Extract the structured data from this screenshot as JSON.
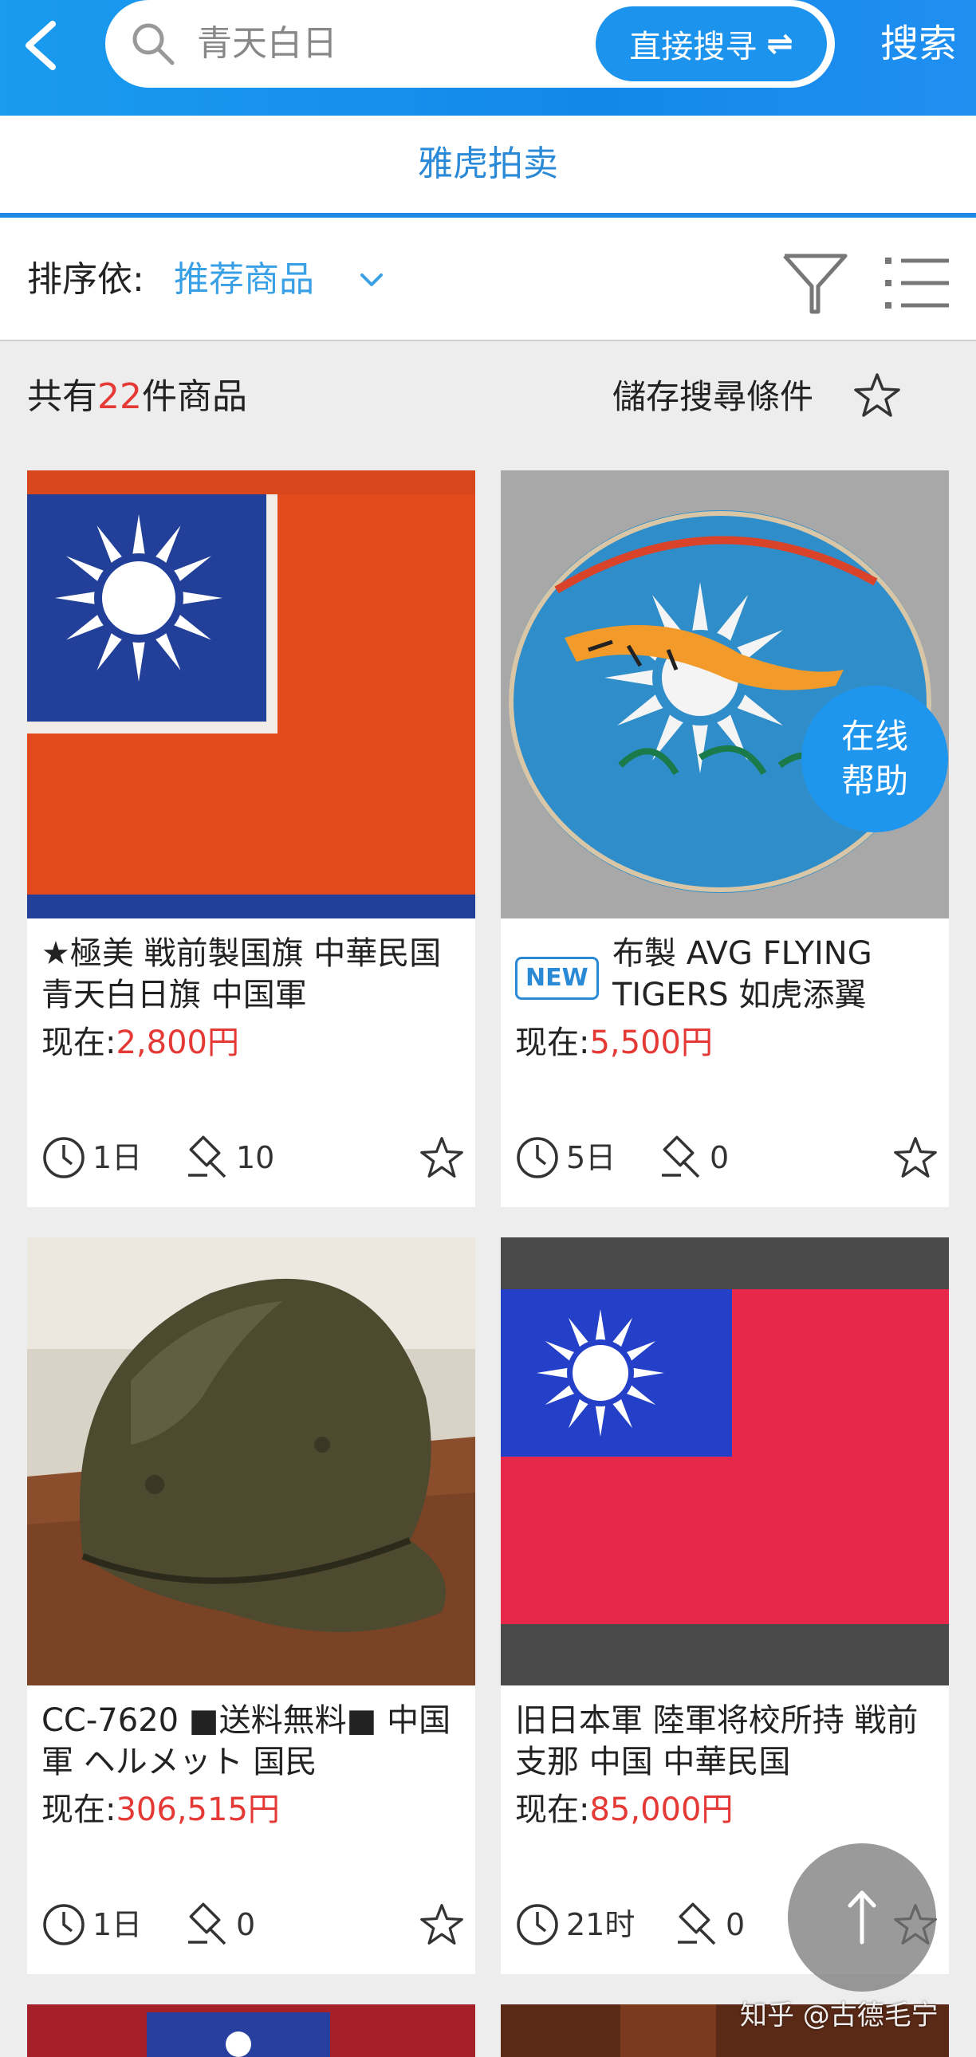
{
  "header": {
    "search_placeholder": "青天白日",
    "direct_search_label": "直接搜寻",
    "direct_search_icon": "⇌",
    "search_button": "搜索",
    "accent": "#1a9bef"
  },
  "tab": {
    "label": "雅虎拍卖"
  },
  "sort": {
    "label": "排序依:",
    "value": "推荐商品"
  },
  "results": {
    "prefix": "共有",
    "count": "22",
    "suffix": "件商品",
    "save_label": "儲存搜尋條件"
  },
  "items": [
    {
      "title": "★極美 戦前製国旗 中華民国 青天白日旗 中国軍",
      "price_label": "现在:",
      "price": "2,800円",
      "time": "1日",
      "bids": "10",
      "badge": ""
    },
    {
      "title": "布製 AVG FLYING TIGERS 如虎添翼",
      "price_label": "现在:",
      "price": "5,500円",
      "time": "5日",
      "bids": "0",
      "badge": "NEW"
    },
    {
      "title": "CC-7620 ■送料無料■ 中国軍 ヘルメット 国民",
      "price_label": "现在:",
      "price": "306,515円",
      "time": "1日",
      "bids": "0",
      "badge": ""
    },
    {
      "title": "旧日本軍 陸軍将校所持 戦前 支那 中国 中華民国",
      "price_label": "现在:",
      "price": "85,000円",
      "time": "21时",
      "bids": "0",
      "badge": ""
    }
  ],
  "help": {
    "line1": "在线",
    "line2": "帮助"
  },
  "watermark": "知乎 @古德毛宁"
}
